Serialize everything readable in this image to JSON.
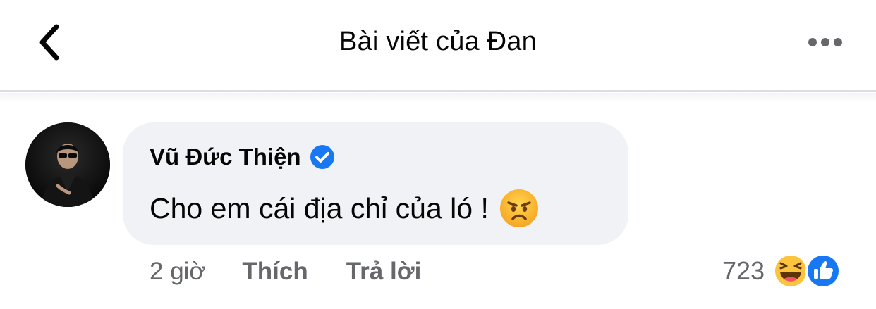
{
  "header": {
    "title": "Bài viết của Đan",
    "back_icon": "chevron-left-icon",
    "more_icon": "more-horizontal-icon"
  },
  "comment": {
    "author": "Vũ Đức Thiện",
    "verified": true,
    "text": "Cho em cái địa chỉ của ló !",
    "emoji": "angry-face-emoji",
    "time": "2 giờ",
    "like_label": "Thích",
    "reply_label": "Trả lời",
    "reaction_count": "723",
    "reactions": [
      "haha-icon",
      "like-icon"
    ]
  },
  "colors": {
    "text": "#050505",
    "secondary_text": "#65676b",
    "bubble": "#f0f2f5",
    "verified_blue": "#1877f2",
    "divider": "#dcdde1"
  }
}
